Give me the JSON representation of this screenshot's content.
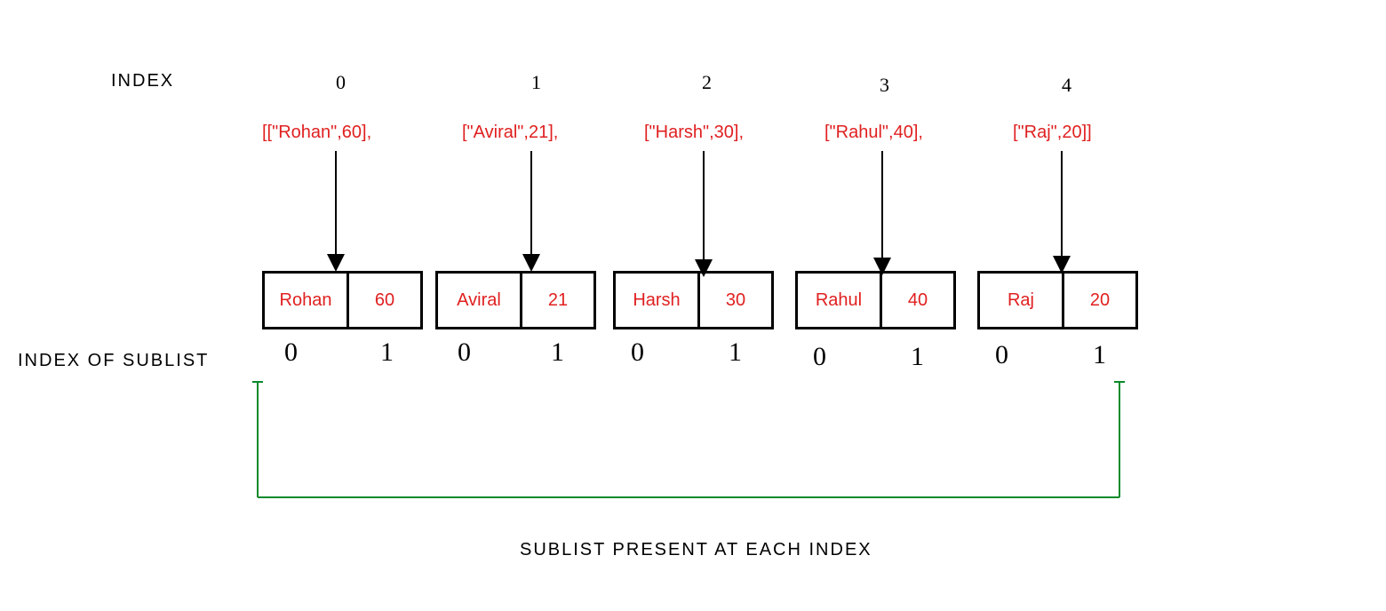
{
  "labels": {
    "index": "INDEX",
    "index_of_sublist": "INDEX OF SUBLIST",
    "footer": "SUBLIST PRESENT AT EACH INDEX"
  },
  "indices": [
    "0",
    "1",
    "2",
    "3",
    "4"
  ],
  "sublist_texts": [
    "[[\"Rohan\",60],",
    "[\"Aviral\",21],",
    "[\"Harsh\",30],",
    "[\"Rahul\",40],",
    "[\"Raj\",20]]"
  ],
  "boxes": [
    {
      "name": "Rohan",
      "value": "60"
    },
    {
      "name": "Aviral",
      "value": "21"
    },
    {
      "name": "Harsh",
      "value": "30"
    },
    {
      "name": "Rahul",
      "value": "40"
    },
    {
      "name": "Raj",
      "value": "20"
    }
  ],
  "sub_indices": [
    "0",
    "1"
  ],
  "chart_data": {
    "type": "table",
    "title": "Sublist present at each index",
    "rows": [
      {
        "index": 0,
        "sublist": [
          "Rohan",
          60
        ]
      },
      {
        "index": 1,
        "sublist": [
          "Aviral",
          21
        ]
      },
      {
        "index": 2,
        "sublist": [
          "Harsh",
          30
        ]
      },
      {
        "index": 3,
        "sublist": [
          "Rahul",
          40
        ]
      },
      {
        "index": 4,
        "sublist": [
          "Raj",
          20
        ]
      }
    ],
    "sub_index_labels": [
      0,
      1
    ]
  }
}
